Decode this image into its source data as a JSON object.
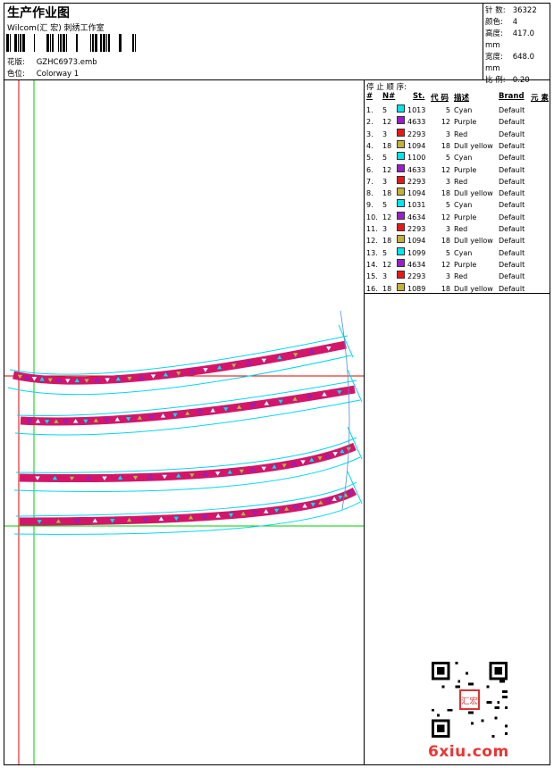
{
  "header": {
    "title": "生产作业图",
    "company": "Wilcom(汇 宏) 刺绣工作室",
    "design_label": "花版:",
    "design_value": "GZHC6973.emb",
    "colorway_label": "色位:",
    "colorway_value": "Colorway 1"
  },
  "specs": [
    {
      "label": "针 数:",
      "value": "36322"
    },
    {
      "label": "颜色:",
      "value": "4"
    },
    {
      "label": "高度:",
      "value": "417.0 mm"
    },
    {
      "label": "宽度:",
      "value": "648.0 mm"
    },
    {
      "label": "比 例:",
      "value": "0.20"
    }
  ],
  "stop_sequence": {
    "title": "停 止 顺 序:",
    "headers": {
      "num": "#",
      "n": "N#",
      "st": "St.",
      "code": "代 码",
      "desc": "描述",
      "brand": "Brand",
      "elem": "元 素"
    },
    "rows": [
      {
        "num": "1.",
        "n": "5",
        "color": "#00e5ee",
        "st": "1013",
        "code": "5",
        "desc": "Cyan",
        "brand": "Default"
      },
      {
        "num": "2.",
        "n": "12",
        "color": "#9a1fc9",
        "st": "4633",
        "code": "12",
        "desc": "Purple",
        "brand": "Default"
      },
      {
        "num": "3.",
        "n": "3",
        "color": "#e81818",
        "st": "2293",
        "code": "3",
        "desc": "Red",
        "brand": "Default"
      },
      {
        "num": "4.",
        "n": "18",
        "color": "#c3b13a",
        "st": "1094",
        "code": "18",
        "desc": "Dull yellow",
        "brand": "Default"
      },
      {
        "num": "5.",
        "n": "5",
        "color": "#00e5ee",
        "st": "1100",
        "code": "5",
        "desc": "Cyan",
        "brand": "Default"
      },
      {
        "num": "6.",
        "n": "12",
        "color": "#9a1fc9",
        "st": "4633",
        "code": "12",
        "desc": "Purple",
        "brand": "Default"
      },
      {
        "num": "7.",
        "n": "3",
        "color": "#e81818",
        "st": "2293",
        "code": "3",
        "desc": "Red",
        "brand": "Default"
      },
      {
        "num": "8.",
        "n": "18",
        "color": "#c3b13a",
        "st": "1094",
        "code": "18",
        "desc": "Dull yellow",
        "brand": "Default"
      },
      {
        "num": "9.",
        "n": "5",
        "color": "#00e5ee",
        "st": "1031",
        "code": "5",
        "desc": "Cyan",
        "brand": "Default"
      },
      {
        "num": "10.",
        "n": "12",
        "color": "#9a1fc9",
        "st": "4634",
        "code": "12",
        "desc": "Purple",
        "brand": "Default"
      },
      {
        "num": "11.",
        "n": "3",
        "color": "#e81818",
        "st": "2293",
        "code": "3",
        "desc": "Red",
        "brand": "Default"
      },
      {
        "num": "12.",
        "n": "18",
        "color": "#c3b13a",
        "st": "1094",
        "code": "18",
        "desc": "Dull yellow",
        "brand": "Default"
      },
      {
        "num": "13.",
        "n": "5",
        "color": "#00e5ee",
        "st": "1099",
        "code": "5",
        "desc": "Cyan",
        "brand": "Default"
      },
      {
        "num": "14.",
        "n": "12",
        "color": "#9a1fc9",
        "st": "4634",
        "code": "12",
        "desc": "Purple",
        "brand": "Default"
      },
      {
        "num": "15.",
        "n": "3",
        "color": "#e81818",
        "st": "2293",
        "code": "3",
        "desc": "Red",
        "brand": "Default"
      },
      {
        "num": "16.",
        "n": "18",
        "color": "#c3b13a",
        "st": "1089",
        "code": "18",
        "desc": "Dull yellow",
        "brand": "Default"
      }
    ]
  },
  "colors": {
    "band": "#d4166a",
    "outline": "#00d8f0",
    "red_guide": "#e00000",
    "green_guide": "#00cc00"
  },
  "watermark": {
    "text": "6xiu",
    "suffix": ".com",
    "seal_text": "汇宏"
  }
}
